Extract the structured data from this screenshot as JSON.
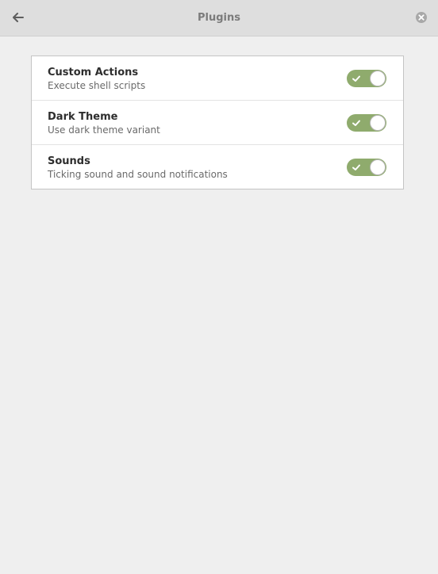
{
  "header": {
    "title": "Plugins",
    "back_icon": "arrow-left-icon",
    "close_icon": "close-icon"
  },
  "plugins": [
    {
      "name": "Custom Actions",
      "description": "Execute shell scripts",
      "enabled": true
    },
    {
      "name": "Dark Theme",
      "description": "Use dark theme variant",
      "enabled": true
    },
    {
      "name": "Sounds",
      "description": "Ticking sound and sound notifications",
      "enabled": true
    }
  ],
  "colors": {
    "toggle_on": "#8fab6d",
    "headerbar": "#dedede",
    "background": "#efefef"
  }
}
